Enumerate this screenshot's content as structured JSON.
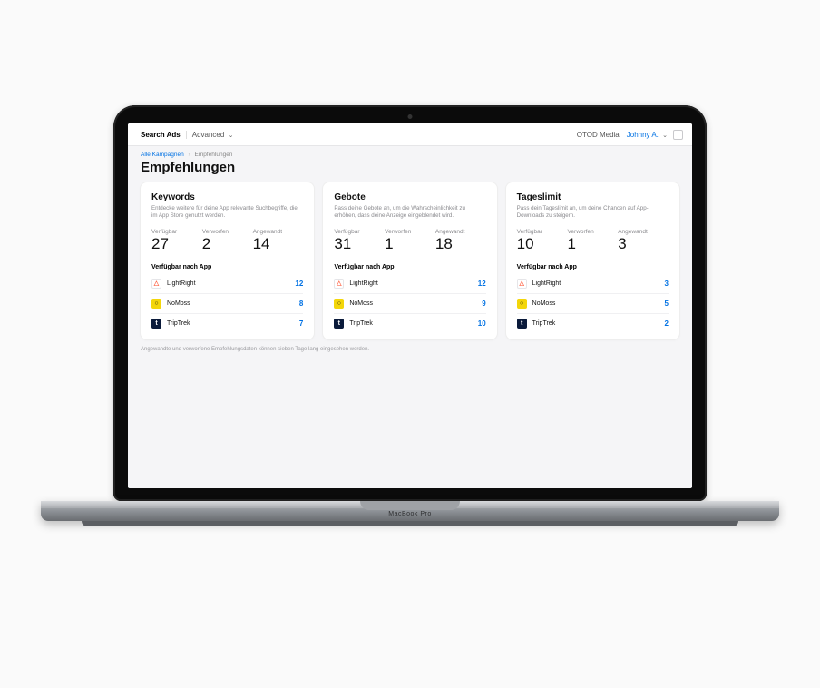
{
  "device": {
    "brand": "MacBook Pro"
  },
  "topbar": {
    "product": "Search Ads",
    "tier": "Advanced",
    "org": "OTOD Media",
    "user": "Johnny A."
  },
  "crumbs": {
    "root": "Alle Kampagnen",
    "current": "Empfehlungen"
  },
  "page": {
    "title": "Empfehlungen",
    "footnote": "Angewandte und verworfene Empfehlungsdaten können sieben Tage lang eingesehen werden."
  },
  "labels": {
    "available": "Verfügbar",
    "dismissed": "Verworfen",
    "applied": "Angewandt",
    "byApp": "Verfügbar nach App"
  },
  "apps": [
    {
      "name": "LightRight"
    },
    {
      "name": "NoMoss"
    },
    {
      "name": "TripTrek"
    }
  ],
  "cards": [
    {
      "title": "Keywords",
      "desc": "Entdecke weitere für deine App relevante Suchbegriffe, die im App Store genutzt werden.",
      "stats": {
        "available": "27",
        "dismissed": "2",
        "applied": "14"
      },
      "apps": [
        "12",
        "8",
        "7"
      ]
    },
    {
      "title": "Gebote",
      "desc": "Pass deine Gebote an, um die Wahrscheinlichkeit zu erhöhen, dass deine Anzeige eingeblendet wird.",
      "stats": {
        "available": "31",
        "dismissed": "1",
        "applied": "18"
      },
      "apps": [
        "12",
        "9",
        "10"
      ]
    },
    {
      "title": "Tageslimit",
      "desc": "Pass dein Tageslimit an, um deine Chancen auf App-Downloads zu steigern.",
      "stats": {
        "available": "10",
        "dismissed": "1",
        "applied": "3"
      },
      "apps": [
        "3",
        "5",
        "2"
      ]
    }
  ]
}
